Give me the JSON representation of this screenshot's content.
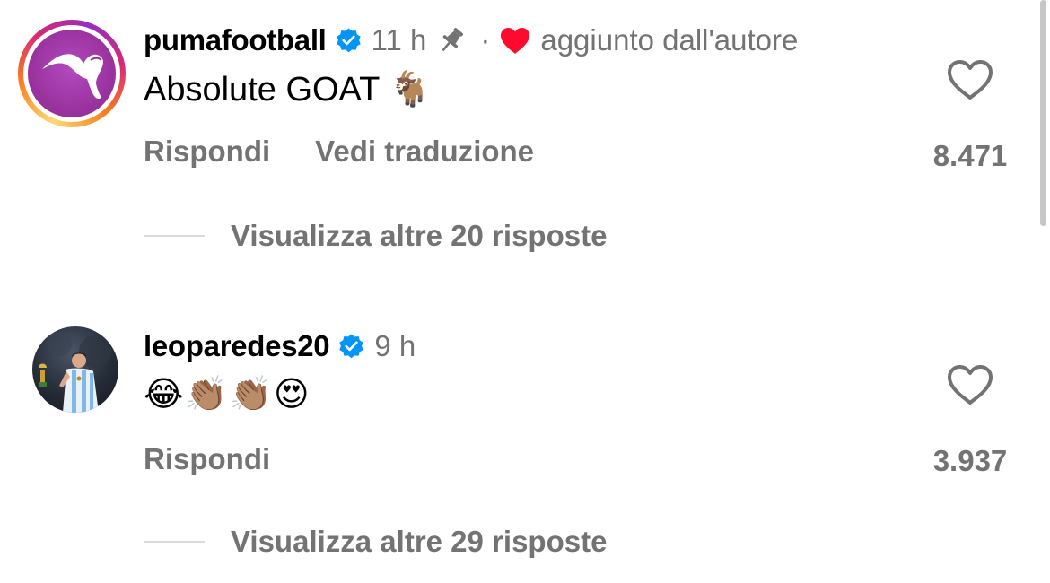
{
  "comments": [
    {
      "username": "pumafootball",
      "verified": true,
      "time": "11 h",
      "pinned": true,
      "separator": "·",
      "liked_by_author": true,
      "liked_by_label": "aggiunto dall'autore",
      "text": "Absolute GOAT 🐐",
      "actions": {
        "reply": "Rispondi",
        "translate": "Vedi traduzione"
      },
      "like_count": "8.471",
      "replies_label": "Visualizza altre 20 risposte",
      "avatar": "puma-logo-avatar"
    },
    {
      "username": "leoparedes20",
      "verified": true,
      "time": "9 h",
      "text": "😂👏🏽👏🏽😍",
      "actions": {
        "reply": "Rispondi"
      },
      "like_count": "3.937",
      "replies_label": "Visualizza altre 29 risposte",
      "avatar": "player-photo-avatar"
    }
  ],
  "colors": {
    "verified_blue": "#0095f6",
    "secondary_text": "#737373",
    "heart_red": "#ff3040",
    "puma_purple": "#9b339f"
  },
  "icons": {
    "verified": "verified-badge-icon",
    "pin": "pin-icon",
    "author_heart": "heart-filled-icon",
    "like": "heart-outline-icon"
  }
}
